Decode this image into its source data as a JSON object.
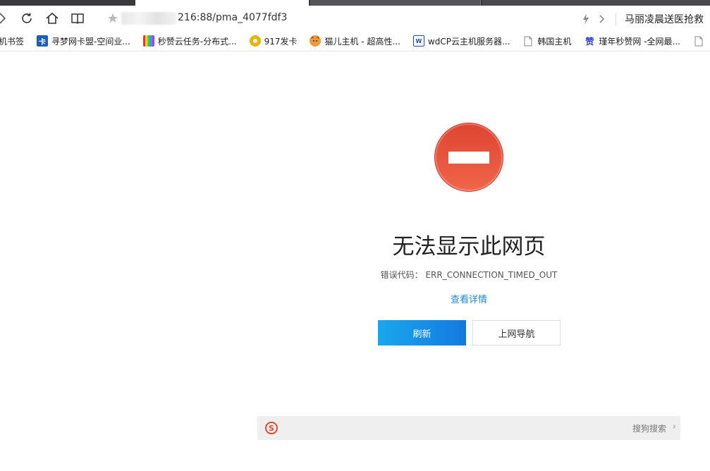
{
  "browser": {
    "url": "216:88/pma_4077fdf3",
    "news_ticker": "马丽凌晨送医抢救"
  },
  "bookmarks": [
    {
      "label": "机书签",
      "icon": "bookmark-folder-icon",
      "color": "#888888"
    },
    {
      "label": "寻梦网卡盟-空间业...",
      "icon": "xunmeng-icon",
      "color": "#1d5fb5"
    },
    {
      "label": "秒赞云任务-分布式...",
      "icon": "miaozan-icon",
      "color": "#d43c8a"
    },
    {
      "label": "917发卡",
      "icon": "chrome-icon",
      "color": "#e8b400"
    },
    {
      "label": "猫儿主机 - 超高性...",
      "icon": "cat-icon",
      "color": "#e8741e"
    },
    {
      "label": "wdCP云主机服务器...",
      "icon": "wdcp-icon",
      "color": "#1d4fb5"
    },
    {
      "label": "韩国主机",
      "icon": "page-icon",
      "color": "#888888"
    },
    {
      "label": "瑾年秒赞网 -全网最...",
      "icon": "jinnian-icon",
      "color": "#2a3bd6"
    }
  ],
  "error": {
    "title": "无法显示此网页",
    "code_label": "错误代码：",
    "code": "ERR_CONNECTION_TIMED_OUT",
    "details_link": "查看详情",
    "refresh_button": "刷新",
    "nav_button": "上网导航"
  },
  "search": {
    "label": "搜狗搜索",
    "logo_letter": "S"
  },
  "colors": {
    "accent": "#1379e0",
    "error_red": "#e3492d",
    "link": "#1e88d0"
  }
}
